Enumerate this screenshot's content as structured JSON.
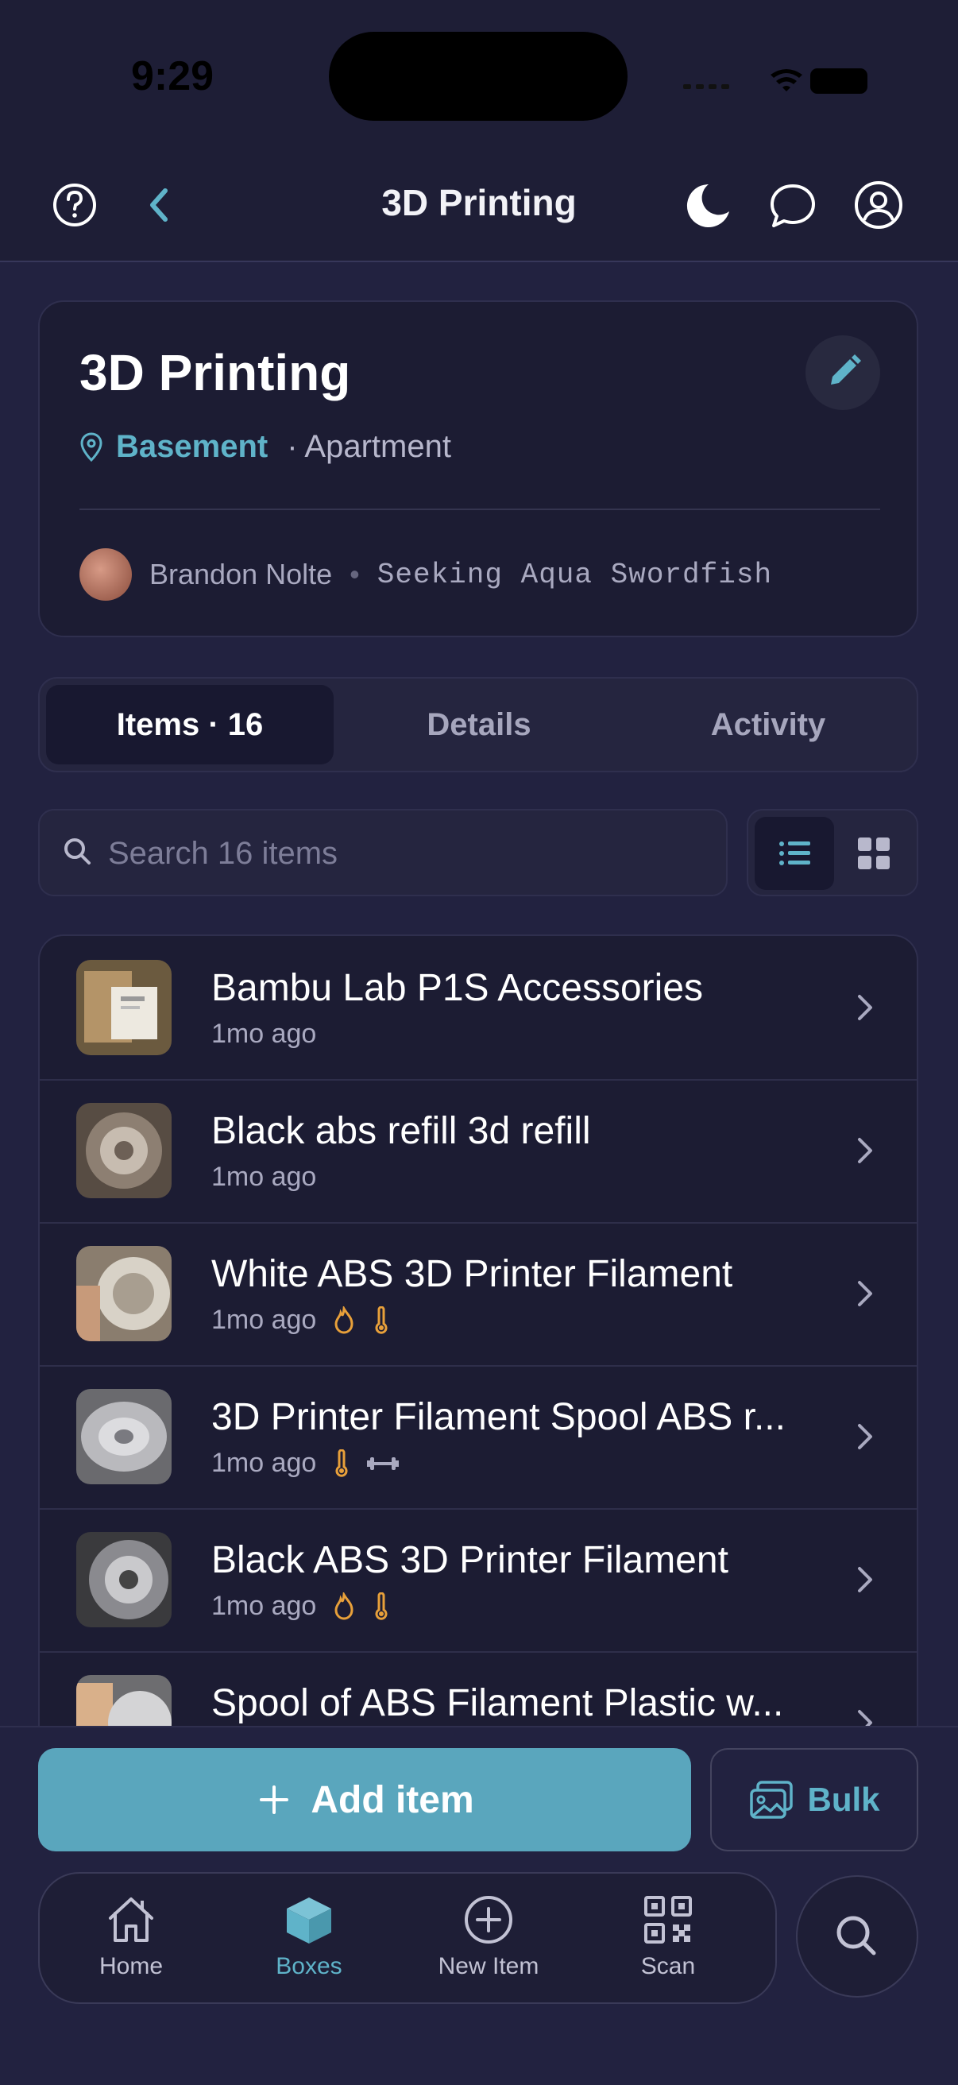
{
  "status_bar": {
    "time": "9:29"
  },
  "header": {
    "title": "3D Printing"
  },
  "box": {
    "title": "3D Printing",
    "location": "Basement",
    "location_parent": "· Apartment",
    "owner": "Brandon Nolte",
    "code": "Seeking Aqua Swordfish"
  },
  "tabs": {
    "items": "Items · 16",
    "details": "Details",
    "activity": "Activity"
  },
  "search": {
    "placeholder": "Search 16 items"
  },
  "items": [
    {
      "name": "Bambu Lab P1S Accessories",
      "time": "1mo ago",
      "tags": []
    },
    {
      "name": "Black abs refill 3d refill",
      "time": "1mo ago",
      "tags": []
    },
    {
      "name": "White ABS 3D Printer Filament",
      "time": "1mo ago",
      "tags": [
        "flame-icon",
        "thermometer-icon"
      ]
    },
    {
      "name": "3D Printer Filament Spool ABS r...",
      "time": "1mo ago",
      "tags": [
        "thermometer-icon",
        "dumbbell-icon"
      ]
    },
    {
      "name": "Black ABS 3D Printer Filament",
      "time": "1mo ago",
      "tags": [
        "flame-icon",
        "thermometer-icon"
      ]
    },
    {
      "name": "Spool of ABS Filament Plastic w...",
      "time": "",
      "tags": []
    }
  ],
  "actions": {
    "add_item": "Add item",
    "bulk": "Bulk"
  },
  "tabbar": {
    "home": "Home",
    "boxes": "Boxes",
    "new_item": "New Item",
    "scan": "Scan"
  },
  "colors": {
    "accent": "#5fb3c9",
    "background": "#222240",
    "card": "#1c1c33",
    "tag_icon": "#e8a03a"
  }
}
